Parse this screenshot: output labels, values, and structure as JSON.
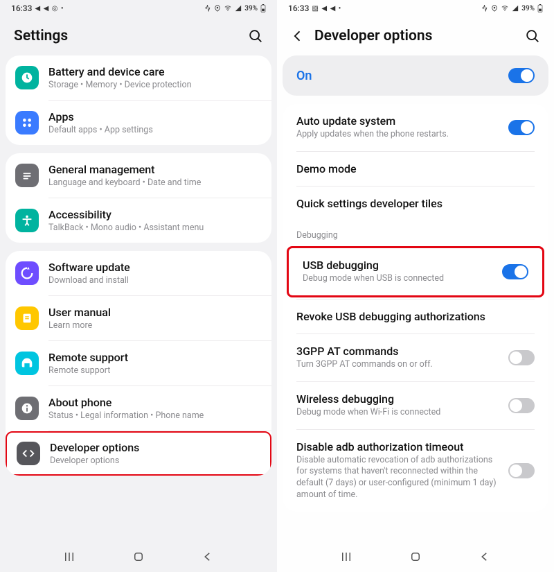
{
  "left": {
    "status": {
      "time": "16:33",
      "icons_left": "◄ ◄ ◎ •",
      "icons_right": "⋮ ◉ ⦾ ▴ 39% ▮"
    },
    "title": "Settings",
    "groups": [
      {
        "items": [
          {
            "title": "Battery and device care",
            "sub": "Storage  •  Memory  •  Device protection",
            "icon_bg": "#00b39f",
            "icon_glyph": "device-care"
          },
          {
            "title": "Apps",
            "sub": "Default apps  •  App settings",
            "icon_bg": "#3a7bff",
            "icon_glyph": "apps"
          }
        ]
      },
      {
        "items": [
          {
            "title": "General management",
            "sub": "Language and keyboard  •  Date and time",
            "icon_bg": "#6e6e73",
            "icon_glyph": "general"
          },
          {
            "title": "Accessibility",
            "sub": "TalkBack  •  Mono audio  •  Assistant menu",
            "icon_bg": "#00b39f",
            "icon_glyph": "accessibility"
          }
        ]
      },
      {
        "items": [
          {
            "title": "Software update",
            "sub": "Download and install",
            "icon_bg": "#6e4dff",
            "icon_glyph": "update"
          },
          {
            "title": "User manual",
            "sub": "Learn more",
            "icon_bg": "#ffc700",
            "icon_glyph": "manual"
          },
          {
            "title": "Remote support",
            "sub": "Remote support",
            "icon_bg": "#00c5e0",
            "icon_glyph": "support"
          },
          {
            "title": "About phone",
            "sub": "Status  •  Legal information  •  Phone name",
            "icon_bg": "#6e6e73",
            "icon_glyph": "about"
          },
          {
            "title": "Developer options",
            "sub": "Developer options",
            "icon_bg": "#56565b",
            "icon_glyph": "dev",
            "highlighted": true
          }
        ]
      }
    ]
  },
  "right": {
    "status": {
      "time": "16:33",
      "icons_left": "🖼 ◄ ◄ •",
      "icons_right": "⋮ ◉ ⦾ ▴ 39% ▮"
    },
    "title": "Developer options",
    "master": {
      "label": "On",
      "on": true
    },
    "items": [
      {
        "title": "Auto update system",
        "sub": "Apply updates when the phone restarts.",
        "toggle": "on"
      },
      {
        "title": "Demo mode",
        "sub": "",
        "toggle": ""
      },
      {
        "title": "Quick settings developer tiles",
        "sub": "",
        "toggle": ""
      }
    ],
    "debug_section": "Debugging",
    "debug_items": [
      {
        "title": "USB debugging",
        "sub": "Debug mode when USB is connected",
        "toggle": "on",
        "highlighted": true
      },
      {
        "title": "Revoke USB debugging authorizations",
        "sub": "",
        "toggle": ""
      },
      {
        "title": "3GPP AT commands",
        "sub": "Turn 3GPP AT commands on or off.",
        "toggle": "off"
      },
      {
        "title": "Wireless debugging",
        "sub": "Debug mode when Wi-Fi is connected",
        "toggle": "off"
      },
      {
        "title": "Disable adb authorization timeout",
        "sub": "Disable automatic revocation of adb authorizations for systems that haven't reconnected within the default (7 days) or user-configured (minimum 1 day) amount of time.",
        "toggle": "off"
      }
    ]
  }
}
